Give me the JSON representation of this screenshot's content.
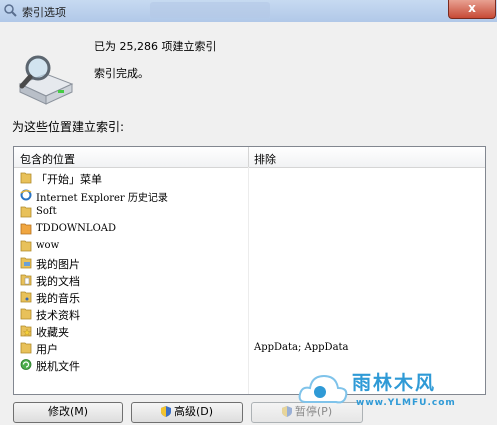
{
  "window": {
    "title": "索引选项",
    "close_label": "x"
  },
  "status": {
    "indexed_text": "已为 25,286 项建立索引",
    "complete_text": "索引完成。"
  },
  "locations": {
    "section_label": "为这些位置建立索引:",
    "col_location": "包含的位置",
    "col_exclude": "排除",
    "items": [
      {
        "name": "「开始」菜单",
        "exclude": "",
        "icon": "folder-icon"
      },
      {
        "name": "Internet Explorer 历史记录",
        "exclude": "",
        "icon": "ie-icon"
      },
      {
        "name": "Soft",
        "exclude": "",
        "icon": "folder-icon"
      },
      {
        "name": "TDDOWNLOAD",
        "exclude": "",
        "icon": "folder-download-icon"
      },
      {
        "name": "wow",
        "exclude": "",
        "icon": "folder-icon"
      },
      {
        "name": "我的图片",
        "exclude": "",
        "icon": "folder-pictures-icon"
      },
      {
        "name": "我的文档",
        "exclude": "",
        "icon": "folder-documents-icon"
      },
      {
        "name": "我的音乐",
        "exclude": "",
        "icon": "folder-music-icon"
      },
      {
        "name": "技术资料",
        "exclude": "",
        "icon": "folder-icon"
      },
      {
        "name": "收藏夹",
        "exclude": "",
        "icon": "favorites-folder-icon"
      },
      {
        "name": "用户",
        "exclude": "AppData; AppData",
        "icon": "folder-icon"
      },
      {
        "name": "脱机文件",
        "exclude": "",
        "icon": "offline-files-icon"
      }
    ]
  },
  "buttons": {
    "modify": "修改(M)",
    "advanced": "高级(D)",
    "pause": "暂停(P)"
  },
  "watermark": {
    "text": "雨林木风",
    "url": "www.YLMFU.com"
  },
  "colors": {
    "folder": "#e8c15a",
    "accent": "#2f9ad6"
  }
}
